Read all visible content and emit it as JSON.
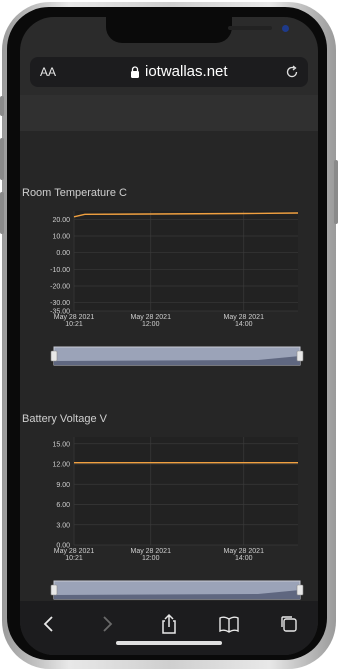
{
  "browser": {
    "text_size_label": "AA",
    "domain": "iotwallas.net"
  },
  "charts": [
    {
      "title": "Room Temperature C",
      "y_ticks": [
        "20.00",
        "10.00",
        "0.00",
        "-10.00",
        "-20.00",
        "-30.00",
        "-35.00"
      ],
      "x_ticks": [
        {
          "line1": "May 28 2021",
          "line2": "10:21"
        },
        {
          "line1": "May 28 2021",
          "line2": "12:00"
        },
        {
          "line1": "May 28 2021",
          "line2": "14:00"
        }
      ]
    },
    {
      "title": "Battery Voltage V",
      "y_ticks": [
        "15.00",
        "12.00",
        "9.00",
        "6.00",
        "3.00",
        "0.00"
      ],
      "x_ticks": [
        {
          "line1": "May 28 2021",
          "line2": "10:21"
        },
        {
          "line1": "May 28 2021",
          "line2": "12:00"
        },
        {
          "line1": "May 28 2021",
          "line2": "14:00"
        }
      ]
    }
  ],
  "chart_data": [
    {
      "type": "line",
      "title": "Room Temperature C",
      "x": [
        "May 28 2021 10:21",
        "May 28 2021 10:35",
        "May 28 2021 12:00",
        "May 28 2021 14:00",
        "May 28 2021 15:10"
      ],
      "series": [
        {
          "values": [
            21.5,
            23.0,
            23.2,
            23.5,
            23.8
          ]
        }
      ],
      "ylim": [
        -35,
        25
      ],
      "line_color": "#f0a040"
    },
    {
      "type": "line",
      "title": "Battery Voltage V",
      "x": [
        "May 28 2021 10:21",
        "May 28 2021 12:00",
        "May 28 2021 14:00",
        "May 28 2021 15:10"
      ],
      "series": [
        {
          "values": [
            12.2,
            12.2,
            12.2,
            12.2
          ]
        }
      ],
      "ylim": [
        0,
        16
      ],
      "line_color": "#f0a040"
    }
  ],
  "toolbar": {
    "icons": [
      "back-icon",
      "forward-icon",
      "share-icon",
      "bookmarks-icon",
      "tabs-icon"
    ]
  }
}
